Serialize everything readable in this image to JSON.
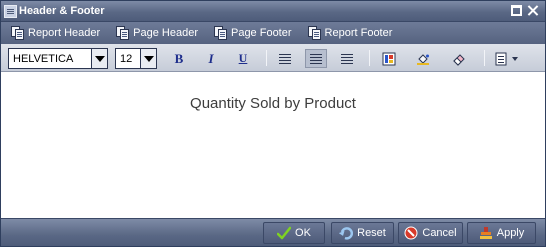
{
  "window": {
    "title": "Header & Footer",
    "title_icon": "header-footer-icon",
    "controls": [
      "maximize-icon",
      "close-icon"
    ]
  },
  "header_tabs": [
    {
      "label": "Report Header",
      "icon": "document-icon"
    },
    {
      "label": "Page Header",
      "icon": "document-icon"
    },
    {
      "label": "Page Footer",
      "icon": "document-icon"
    },
    {
      "label": "Report Footer",
      "icon": "document-icon"
    }
  ],
  "format_toolbar": {
    "font_value": "HELVETICA",
    "size_value": "12",
    "bold": "B",
    "italic": "I",
    "underline": "U",
    "alignment_selected": "center",
    "tools": [
      "align-left-icon",
      "align-center-icon",
      "align-right-icon",
      "text-color-icon",
      "fill-color-icon",
      "eraser-icon",
      "insert-menu-icon"
    ]
  },
  "content": {
    "text": "Quantity Sold by Product"
  },
  "footer_buttons": {
    "ok": "OK",
    "reset": "Reset",
    "cancel": "Cancel",
    "apply": "Apply"
  },
  "colors": {
    "titlebar": "#5a6885",
    "toolbar": "#c6ccd8",
    "text_accent": "#1e2e8c"
  }
}
